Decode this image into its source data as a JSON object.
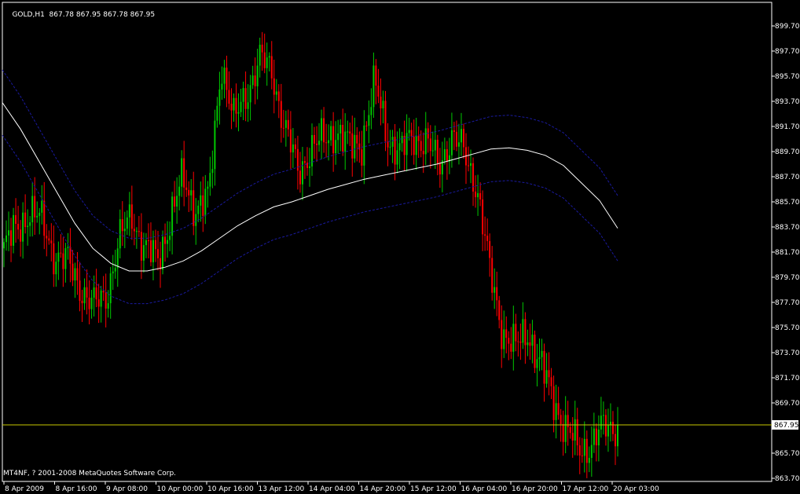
{
  "header": {
    "symbol": "GOLD,H1",
    "ohlc": "867.78 867.95 867.78 867.95"
  },
  "copyright": "MT4NF, ? 2001-2008 MetaQuotes Software Corp.",
  "colors": {
    "background": "#000000",
    "bull": "#00C800",
    "bear": "#FF0000",
    "ma": "#FFFFFF",
    "envelope": "#1A1AA0",
    "price_line": "#C8C800",
    "frame": "#FFFFFF"
  },
  "chart_data": {
    "type": "candlestick",
    "ylim": [
      863.3,
      900.6
    ],
    "y_ticks": [
      "899.70",
      "897.70",
      "895.70",
      "893.70",
      "891.70",
      "889.70",
      "887.70",
      "885.70",
      "883.70",
      "881.70",
      "879.70",
      "877.70",
      "875.70",
      "873.70",
      "871.70",
      "869.70",
      "867.95",
      "865.70",
      "863.70"
    ],
    "x_ticks": [
      "8 Apr 2009",
      "8 Apr 16:00",
      "9 Apr 08:00",
      "10 Apr 00:00",
      "10 Apr 16:00",
      "13 Apr 12:00",
      "14 Apr 04:00",
      "14 Apr 20:00",
      "15 Apr 12:00",
      "16 Apr 04:00",
      "16 Apr 20:00",
      "17 Apr 12:00",
      "20 Apr 03:00"
    ],
    "current_price": 867.95,
    "close": [
      882,
      883.5,
      885,
      884,
      881.5,
      880.8,
      879,
      877.3,
      878.3,
      882.5,
      884.7,
      882,
      881,
      884.3,
      887.5,
      885.3,
      885.8,
      897,
      892,
      894.5,
      897,
      896,
      891.5,
      888,
      890,
      890.5,
      891.5,
      890,
      890.5,
      895,
      891,
      889.5,
      891,
      890.5,
      888.5,
      891,
      889.5,
      887,
      880,
      875.5,
      874,
      875.5,
      872.5,
      870,
      867.5,
      866,
      866.5,
      867.8,
      867.95
    ],
    "ma": [
      893.6,
      891.5,
      889.0,
      886.5,
      884.0,
      882.0,
      880.8,
      880.2,
      880.2,
      880.5,
      881.0,
      881.8,
      882.8,
      883.8,
      884.6,
      885.3,
      885.7,
      886.2,
      886.7,
      887.1,
      887.5,
      887.8,
      888.1,
      888.4,
      888.7,
      889.1,
      889.5,
      889.9,
      890.0,
      889.8,
      889.4,
      888.6,
      887.2,
      885.8,
      883.6
    ],
    "ma_start_index": 0,
    "ma_end_index": 40,
    "envelope_offset": 2.6
  }
}
